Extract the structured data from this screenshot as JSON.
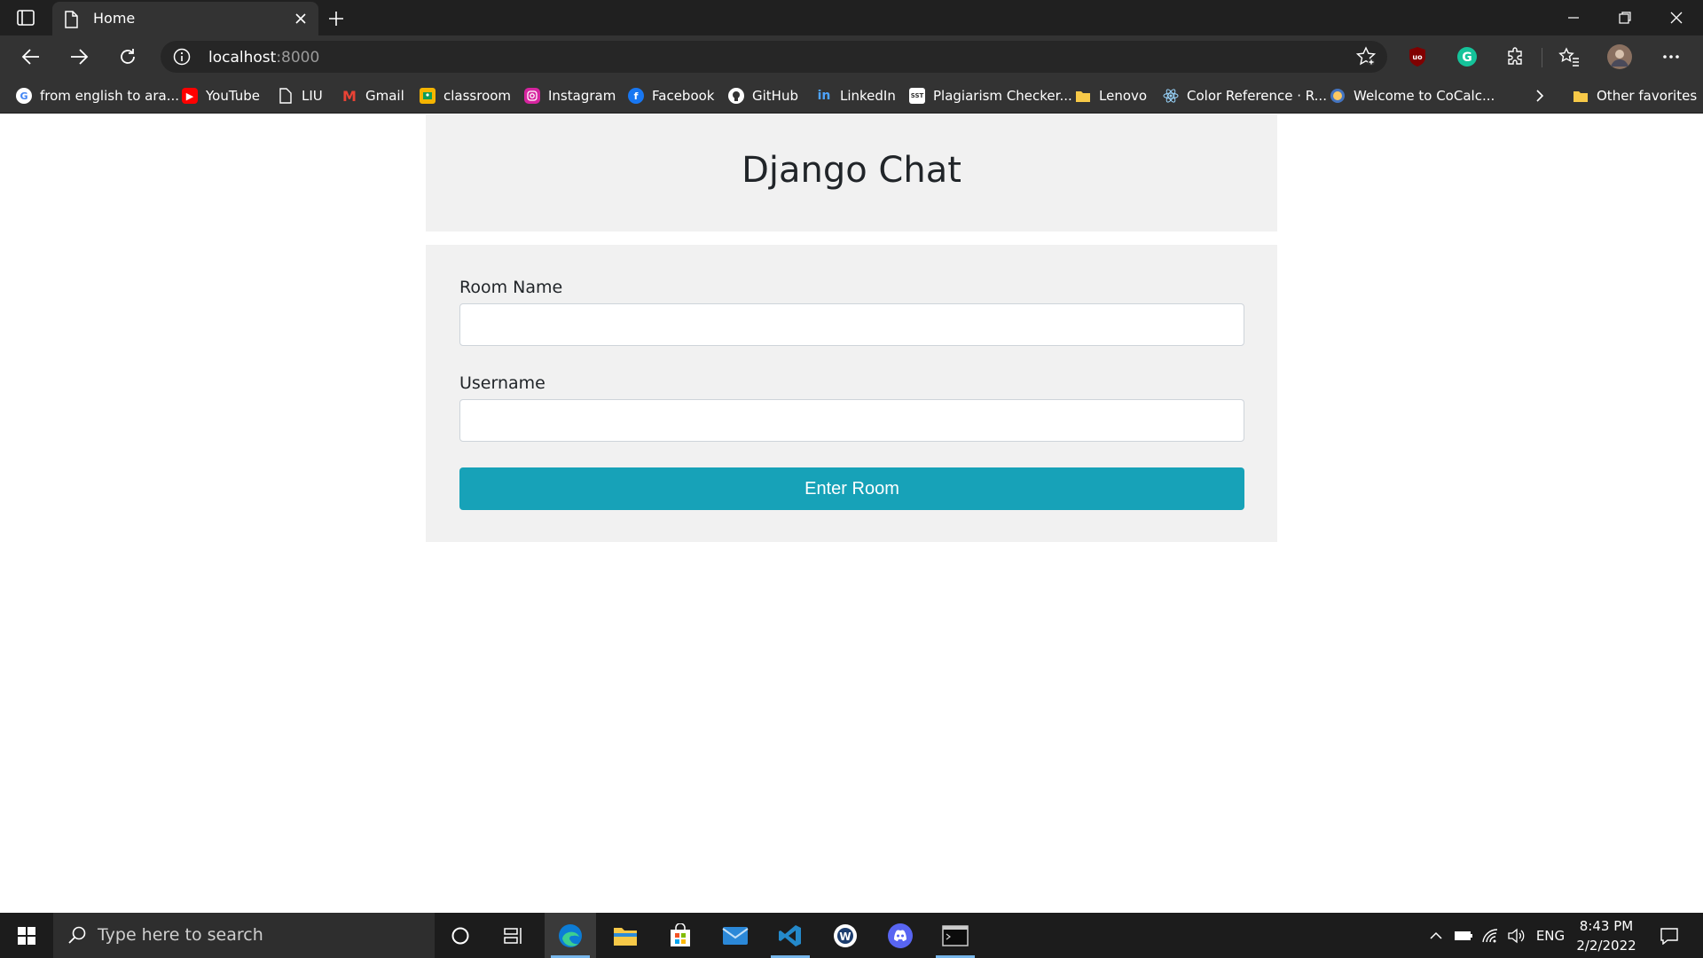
{
  "browser": {
    "tab_title": "Home",
    "url_host": "localhost",
    "url_port": ":8000"
  },
  "favorites": [
    {
      "label": "from english to ara...",
      "icon": "google-icon"
    },
    {
      "label": "YouTube",
      "icon": "youtube-icon"
    },
    {
      "label": "LIU",
      "icon": "page-icon"
    },
    {
      "label": "Gmail",
      "icon": "gmail-icon"
    },
    {
      "label": "classroom",
      "icon": "classroom-icon"
    },
    {
      "label": "Instagram",
      "icon": "instagram-icon"
    },
    {
      "label": "Facebook",
      "icon": "facebook-icon"
    },
    {
      "label": "GitHub",
      "icon": "github-icon"
    },
    {
      "label": "LinkedIn",
      "icon": "linkedin-icon"
    },
    {
      "label": "Plagiarism Checker...",
      "icon": "sst-icon"
    },
    {
      "label": "Lenovo",
      "icon": "folder-icon"
    },
    {
      "label": "Color Reference · R...",
      "icon": "react-icon"
    },
    {
      "label": "Welcome to CoCalc...",
      "icon": "cocalc-icon"
    }
  ],
  "other_favorites": "Other favorites",
  "page": {
    "title": "Django Chat",
    "room_label": "Room Name",
    "username_label": "Username",
    "submit_label": "Enter Room"
  },
  "taskbar": {
    "search_placeholder": "Type here to search",
    "language": "ENG",
    "time": "8:43 PM",
    "date": "2/2/2022"
  },
  "colors": {
    "accent_button": "#17a2b8",
    "panel_background": "#f1f1f1"
  }
}
